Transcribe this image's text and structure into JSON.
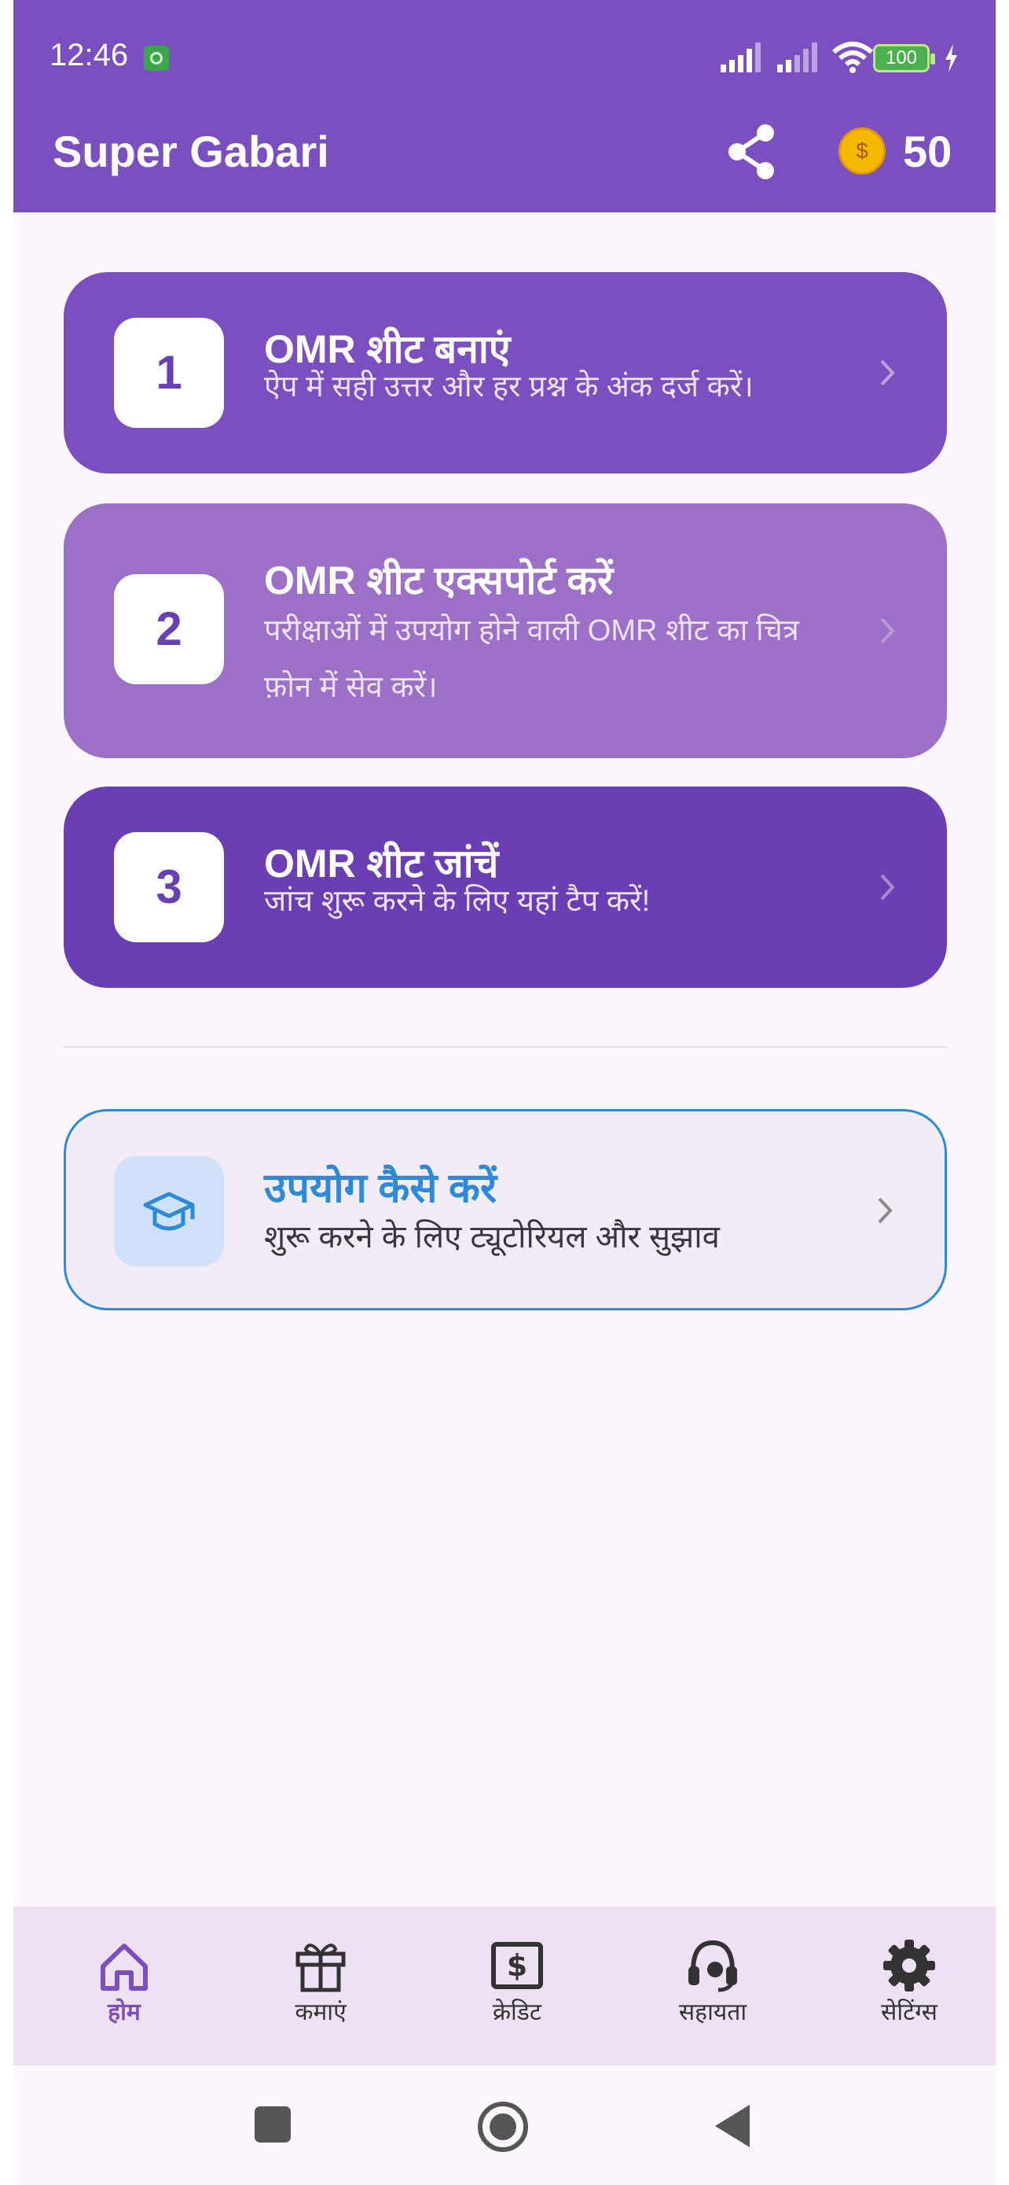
{
  "status_bar": {
    "time": "12:46",
    "battery": "100"
  },
  "header": {
    "title": "Super Gabari",
    "coin_symbol": "$",
    "coins": "50"
  },
  "steps": [
    {
      "number": "1",
      "title": "OMR शीट बनाएं",
      "description": "ऐप में सही उत्तर और हर प्रश्न के अंक दर्ज करें।"
    },
    {
      "number": "2",
      "title": "OMR शीट एक्सपोर्ट करें",
      "description": "परीक्षाओं में उपयोग होने वाली OMR शीट का चित्र फ़ोन में सेव करें।"
    },
    {
      "number": "3",
      "title": "OMR शीट जांचें",
      "description": "जांच शुरू करने के लिए यहां टैप करें!"
    }
  ],
  "help": {
    "title": "उपयोग कैसे करें",
    "description": "शुरू करने के लिए ट्यूटोरियल और सुझाव"
  },
  "nav": [
    {
      "label": "होम",
      "icon": "home-icon",
      "active": true
    },
    {
      "label": "कमाएं",
      "icon": "gift-icon"
    },
    {
      "label": "क्रेडिट",
      "icon": "dollar-card-icon"
    },
    {
      "label": "सहायता",
      "icon": "headset-icon"
    },
    {
      "label": "सेटिंग्स",
      "icon": "gear-icon"
    }
  ],
  "colors": {
    "primary": "#7b4fc0",
    "step2": "#9b70c6",
    "step3": "#6a3fb3",
    "accent_blue": "#2d8ad8"
  }
}
